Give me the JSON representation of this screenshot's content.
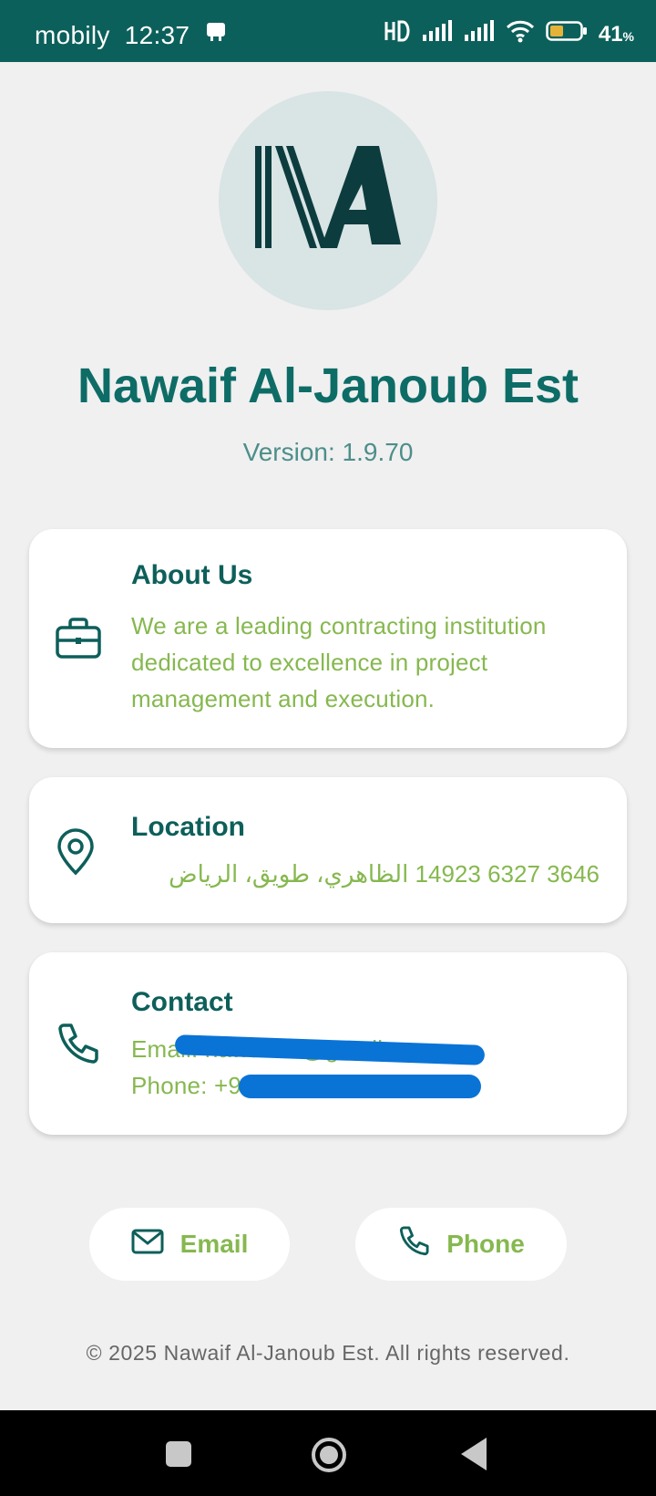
{
  "status_bar": {
    "carrier": "mobily",
    "time": "12:37",
    "battery": "41",
    "battery_unit": "%"
  },
  "header": {
    "title": "Nawaif Al-Janoub Est",
    "version": "Version: 1.9.70"
  },
  "cards": {
    "about": {
      "title": "About Us",
      "body": "We are a leading contracting institution dedicated to excellence in project management and execution.",
      "icon": "briefcase-icon"
    },
    "location": {
      "title": "Location",
      "body": "3646 6327 14923 الظاهري، طويق، الرياض",
      "icon": "location-pin-icon"
    },
    "contact": {
      "title": "Contact",
      "email_line": "Email: nawafest@gmail.com",
      "phone_line": "Phone: +9",
      "icon": "phone-icon"
    }
  },
  "actions": {
    "email_label": "Email",
    "phone_label": "Phone"
  },
  "footer": {
    "text": "© 2025 Nawaif Al-Janoub Est. All rights reserved."
  },
  "colors": {
    "primary": "#0c605b",
    "title": "#0e6c67",
    "accent_green": "#86b84f",
    "background": "#f0f0f0",
    "logo_bg": "#d9e4e4",
    "redaction": "#0a73d6"
  }
}
